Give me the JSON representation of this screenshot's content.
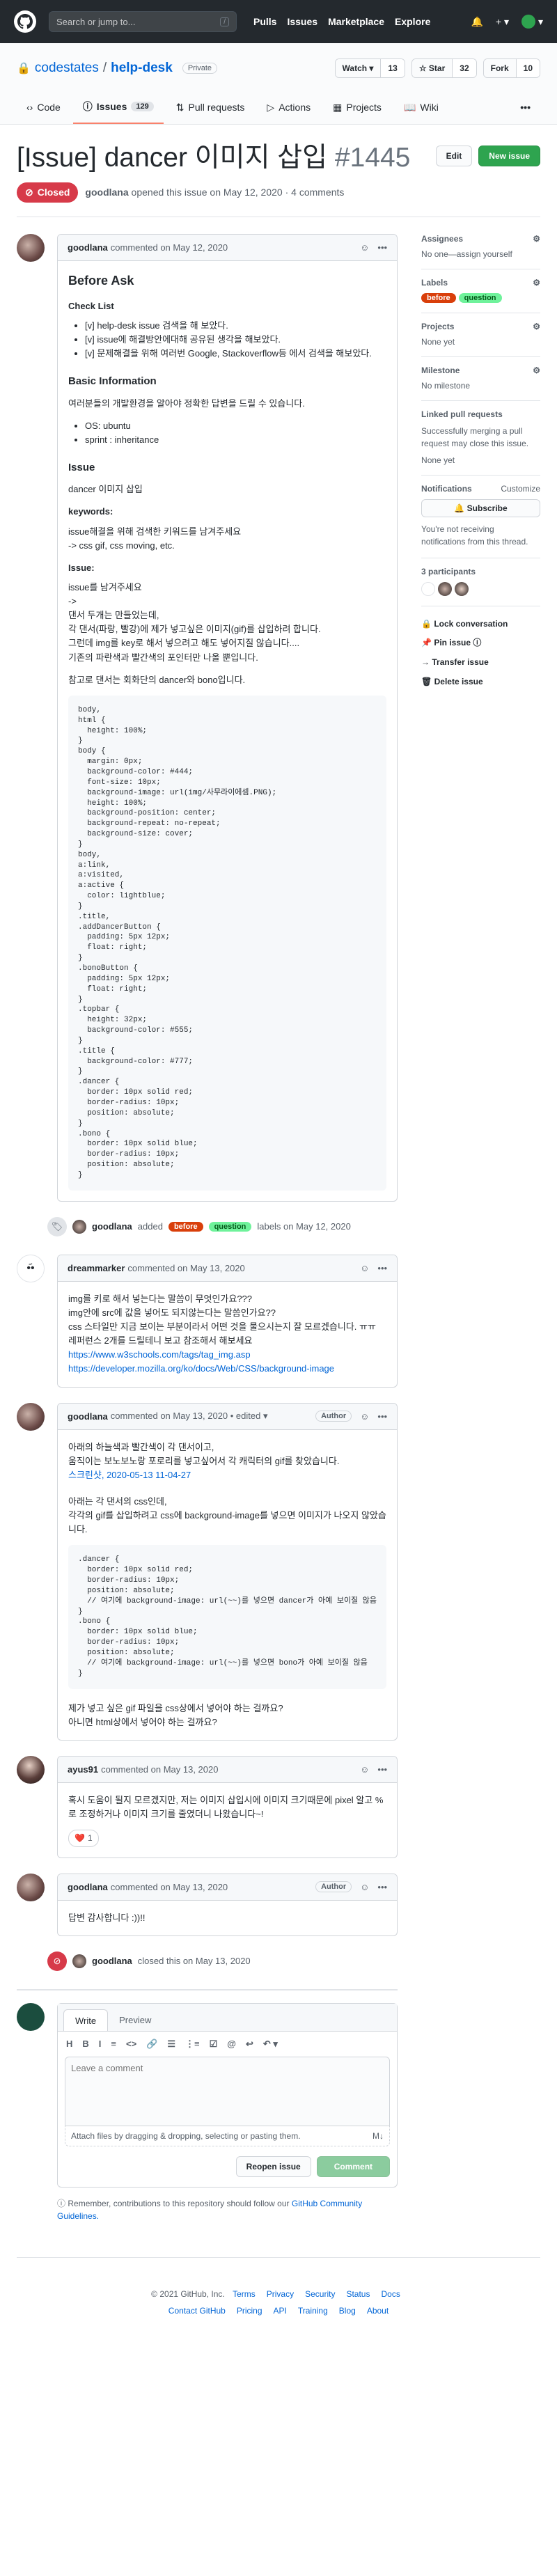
{
  "header": {
    "search_placeholder": "Search or jump to...",
    "search_key": "/",
    "nav": [
      "Pulls",
      "Issues",
      "Marketplace",
      "Explore"
    ],
    "bell": "🔔",
    "plus": "+ ▾",
    "avatar_caret": "▾"
  },
  "repo": {
    "owner": "codestates",
    "separator": "/",
    "name": "help-desk",
    "visibility": "Private",
    "watch_label": "Watch ▾",
    "watch_count": "13",
    "star_label": "☆ Star",
    "star_count": "32",
    "fork_label": "Fork",
    "fork_count": "10"
  },
  "tabs": [
    {
      "label": "Code"
    },
    {
      "label": "Issues",
      "count": "129"
    },
    {
      "label": "Pull requests"
    },
    {
      "label": "Actions"
    },
    {
      "label": "Projects"
    },
    {
      "label": "Wiki"
    }
  ],
  "tabs_more": "•••",
  "issue": {
    "title": "[Issue] dancer 이미지 삽입",
    "number": "#1445",
    "status": "Closed",
    "author": "goodlana",
    "meta": "opened this issue on May 12, 2020 · 4 comments",
    "edit_label": "Edit",
    "new_label": "New issue"
  },
  "first_comment": {
    "author": "goodlana",
    "time": "commented on May 12, 2020",
    "h_before": "Before Ask",
    "h_check": "Check List",
    "checks": [
      "[v] help-desk issue 검색을 해 보았다.",
      "[v] issue에 해결방안에대해 공유된 생각을 해보았다.",
      "[v] 문제해결을 위해 여러번 Google, Stackoverflow등 에서 검색을 해보았다."
    ],
    "h_basic": "Basic Information",
    "basic_p": "여러분들의 개발환경을 알아야 정확한 답변을 드릴 수 있습니다.",
    "env": [
      "OS: ubuntu",
      "sprint : inheritance"
    ],
    "h_issue": "Issue",
    "issue_p": "dancer 이미지 삽입",
    "kw_h": "keywords:",
    "kw_1": "issue해결을 위해 검색한 키워드를 남겨주세요",
    "kw_2": "-> css gif, css moving, etc.",
    "is_h": "Issue:",
    "is_1": "issue를 남겨주세요",
    "is_2": "->",
    "is_3": "댄서 두개는 만들었는데,",
    "is_4": "각 댄서(파랑, 빨강)에 제가 넣고싶은 이미지(gif)를 삽입하려 합니다.",
    "is_5": "그런데 img를 key로 해서 넣으려고 해도 넣어지질 않습니다....",
    "is_6": "기존의 파란색과 빨간색의 포인터만 나올 뿐입니다.",
    "ref": "참고로 댄서는 회화단의 dancer와 bono입니다.",
    "code": "body,\nhtml {\n  height: 100%;\n}\nbody {\n  margin: 0px;\n  background-color: #444;\n  font-size: 10px;\n  background-image: url(img/사무라이에셈.PNG);\n  height: 100%;\n  background-position: center;\n  background-repeat: no-repeat;\n  background-size: cover;\n}\nbody,\na:link,\na:visited,\na:active {\n  color: lightblue;\n}\n.title,\n.addDancerButton {\n  padding: 5px 12px;\n  float: right;\n}\n.bonoButton {\n  padding: 5px 12px;\n  float: right;\n}\n.topbar {\n  height: 32px;\n  background-color: #555;\n}\n.title {\n  background-color: #777;\n}\n.dancer {\n  border: 10px solid red;\n  border-radius: 10px;\n  position: absolute;\n}\n.bono {\n  border: 10px solid blue;\n  border-radius: 10px;\n  position: absolute;\n}"
  },
  "label_event": {
    "author": "goodlana",
    "added": "added",
    "l1": "before",
    "l2": "question",
    "rest": "labels on May 12, 2020"
  },
  "c2": {
    "author": "dreammarker",
    "time": "commented on May 13, 2020",
    "l1": "img를 키로 해서 넣는다는 말씀이 무엇인가요???",
    "l2": "img안에 src에 값을 넣어도 되지않는다는 말씀인가요??",
    "l3": "css 스타일만 지금 보이는 부분이라서 어떤 것을 물으시는지 잘 모르겠습니다. ㅠㅠ",
    "l4": "레퍼런스 2개를 드릴테니 보고 참조해서 해보세요",
    "link1": "https://www.w3schools.com/tags/tag_img.asp",
    "link2": "https://developer.mozilla.org/ko/docs/Web/CSS/background-image"
  },
  "c3": {
    "author": "goodlana",
    "time": "commented on May 13, 2020 • edited ▾",
    "badge": "Author",
    "l1": "아래의 하늘색과 빨간색이 각 댄서이고,",
    "l2": "움직이는 보노보노랑 포로리를 넣고싶어서 각 캐릭터의 gif를 찾았습니다.",
    "link": "스크린샷, 2020-05-13 11-04-27",
    "p2": "아래는 각 댄서의 css인데,",
    "p3": "각각의 gif를 삽입하려고 css에 background-image를 넣으면 이미지가 나오지 않았습니다.",
    "code": ".dancer {\n  border: 10px solid red;\n  border-radius: 10px;\n  position: absolute;\n  // 여기에 background-image: url(~~)를 넣으면 dancer가 아예 보이질 않음\n}\n.bono {\n  border: 10px solid blue;\n  border-radius: 10px;\n  position: absolute;\n  // 여기에 background-image: url(~~)를 넣으면 bono가 아예 보이질 않음\n}",
    "p4": "제가 넣고 싶은 gif 파일을 css상에서 넣어야 하는 걸까요?",
    "p5": "아니면 html상에서 넣어야 하는 걸까요?"
  },
  "c4": {
    "author": "ayus91",
    "time": "commented on May 13, 2020",
    "body": "혹시 도움이 될지 모르겠지만, 저는 이미지 삽입시에 이미지 크기때문에 pixel 알고 %로 조정하거나 이미지 크기를 줄였더니 나왔습니다~!",
    "react": "❤️",
    "react_count": "1"
  },
  "c5": {
    "author": "goodlana",
    "time": "commented on May 13, 2020",
    "badge": "Author",
    "body": "답변 감사합니다 :))!!"
  },
  "close_event": {
    "author": "goodlana",
    "rest": "closed this on May 13, 2020"
  },
  "editor": {
    "write": "Write",
    "preview": "Preview",
    "tools": [
      "H",
      "B",
      "I",
      "≡",
      "<>",
      "🔗",
      "☰",
      "⋮≡",
      "☑",
      "@",
      "↩",
      "↶ ▾"
    ],
    "placeholder": "Leave a comment",
    "attach": "Attach files by dragging & dropping, selecting or pasting them.",
    "md": "M↓",
    "reopen": "Reopen issue",
    "comment": "Comment"
  },
  "remember": "Remember, contributions to this repository should follow our",
  "remember_link": "GitHub Community Guidelines.",
  "sidebar": {
    "assignees": "Assignees",
    "assignees_v": "No one—assign yourself",
    "labels": "Labels",
    "l1": "before",
    "l2": "question",
    "projects": "Projects",
    "projects_v": "None yet",
    "milestone": "Milestone",
    "milestone_v": "No milestone",
    "linked": "Linked pull requests",
    "linked_v": "Successfully merging a pull request may close this issue.",
    "linked_v2": "None yet",
    "notif": "Notifications",
    "customize": "Customize",
    "subscribe": "🔔 Subscribe",
    "notif_v": "You're not receiving notifications from this thread.",
    "participants": "3 participants",
    "lock": "🔒 Lock conversation",
    "pin": "📌 Pin issue ⓘ",
    "transfer": "→ Transfer issue",
    "delete": "🗑 Delete issue"
  },
  "footer": {
    "copy": "© 2021 GitHub, Inc.",
    "links1": [
      "Terms",
      "Privacy",
      "Security",
      "Status",
      "Docs"
    ],
    "links2": [
      "Contact GitHub",
      "Pricing",
      "API",
      "Training",
      "Blog",
      "About"
    ]
  },
  "colors": {
    "header": "#24292e",
    "closed": "#d73a49",
    "green": "#2ea44f",
    "label_before": "#d93f0b",
    "label_question": "#6ff29b"
  }
}
